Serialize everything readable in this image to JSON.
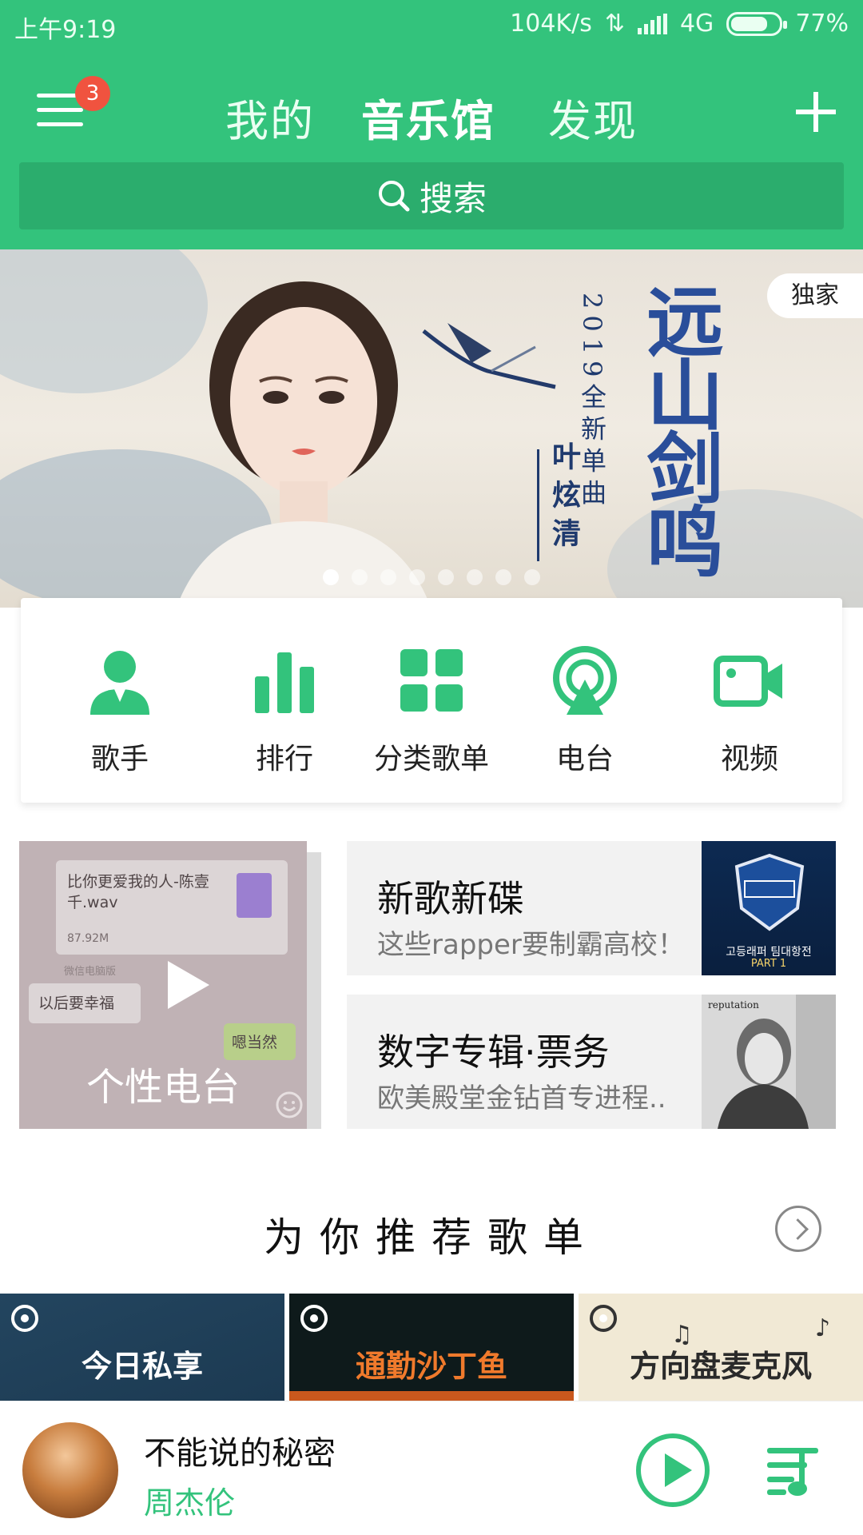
{
  "status": {
    "time": "上午9:19",
    "speed": "104K/s",
    "network": "4G",
    "battery": "77%",
    "battery_level": 0.77
  },
  "header": {
    "menu_badge": "3",
    "tabs": [
      {
        "label": "我的"
      },
      {
        "label": "音乐馆"
      },
      {
        "label": "发现"
      }
    ],
    "active_tab": "音乐馆"
  },
  "search": {
    "label": "搜索"
  },
  "banner": {
    "tag": "独家",
    "year_text": "2019全新单曲",
    "artist_text": "叶炫清",
    "title_text": "远山剑鸣",
    "slide_count": 8,
    "active_slide": 1
  },
  "categories": [
    {
      "label": "歌手",
      "icon": "singer-icon"
    },
    {
      "label": "排行",
      "icon": "chart-icon"
    },
    {
      "label": "分类歌单",
      "icon": "grid-icon"
    },
    {
      "label": "电台",
      "icon": "radio-icon"
    },
    {
      "label": "视频",
      "icon": "video-icon"
    }
  ],
  "personal_radio": {
    "title": "个性电台",
    "chat_file": "比你更爱我的人-陈壹千.wav",
    "chat_size": "87.92M",
    "chat_source": "微信电脑版",
    "chat_left": "以后要幸福",
    "chat_right": "嗯当然"
  },
  "features": [
    {
      "title": "新歌新碟",
      "subtitle": "这些rapper要制霸高校！",
      "thumb_text": "고등래퍼 팀대항전",
      "thumb_sub": "PART 1"
    },
    {
      "title": "数字专辑·票务",
      "subtitle": "欧美殿堂金钻首专进程..",
      "thumb_text": "reputation"
    }
  ],
  "recommend": {
    "title": "为你推荐歌单",
    "playlists": [
      {
        "name": "今日私享"
      },
      {
        "name": "通勤沙丁鱼"
      },
      {
        "name": "方向盘麦克风"
      }
    ]
  },
  "player": {
    "song": "不能说的秘密",
    "artist": "周杰伦"
  },
  "colors": {
    "brand": "#33c37c",
    "brand_dark": "#2bad6d",
    "badge": "#f0533f"
  }
}
